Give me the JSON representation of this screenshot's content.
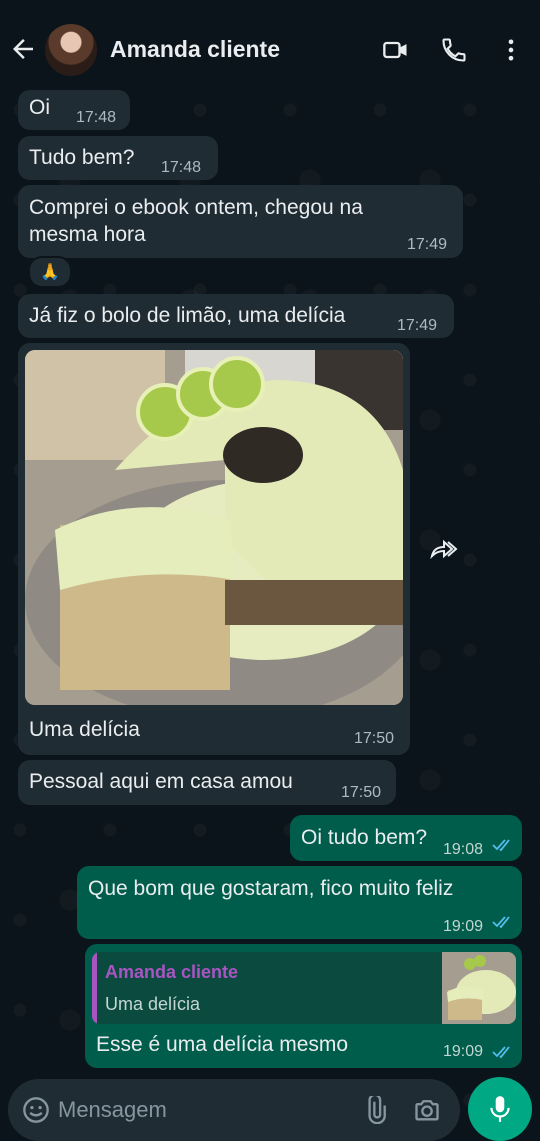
{
  "header": {
    "contact_name": "Amanda cliente",
    "icons": [
      "back-arrow-icon",
      "video-call-icon",
      "phone-icon",
      "more-vertical-icon"
    ]
  },
  "messages": [
    {
      "direction": "in",
      "text": "Oi",
      "time": "17:48"
    },
    {
      "direction": "in",
      "text": "Tudo bem?",
      "time": "17:48"
    },
    {
      "direction": "in",
      "text_line1": "Comprei o ebook ontem, chegou na",
      "text_line2": "mesma hora",
      "time": "17:49",
      "reaction": "🙏"
    },
    {
      "direction": "in",
      "text": "Já fiz o bolo de limão, uma delícia",
      "time": "17:49"
    },
    {
      "direction": "in",
      "type": "image",
      "caption": "Uma delícia",
      "time": "17:50"
    },
    {
      "direction": "in",
      "text": "Pessoal aqui em casa amou",
      "time": "17:50"
    },
    {
      "direction": "out",
      "text": "Oi tudo bem?",
      "time": "19:08",
      "status": "read"
    },
    {
      "direction": "out",
      "text": "Que bom que gostaram, fico muito feliz",
      "time": "19:09",
      "status": "read"
    },
    {
      "direction": "out",
      "quote_name": "Amanda cliente",
      "quote_text": "Uma delícia",
      "text": "Esse é uma delícia mesmo",
      "time": "19:09",
      "status": "read"
    }
  ],
  "input": {
    "placeholder": "Mensagem",
    "icons": [
      "emoji-icon",
      "attach-icon",
      "camera-icon",
      "mic-icon"
    ]
  },
  "colors": {
    "background": "#0b141a",
    "incoming_bubble": "#202c33",
    "outgoing_bubble": "#005c4b",
    "accent": "#00a884",
    "read_ticks": "#53bdeb",
    "quote_name": "#a855c2"
  }
}
